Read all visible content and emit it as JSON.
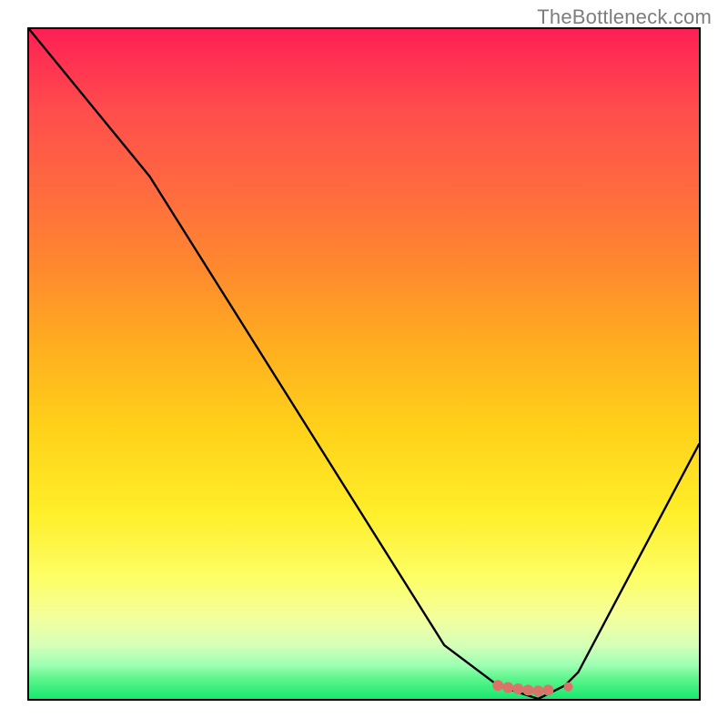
{
  "attribution": {
    "watermark": "TheBottleneck.com"
  },
  "chart_data": {
    "type": "line",
    "title": "",
    "xlabel": "",
    "ylabel": "",
    "xlim": [
      0,
      100
    ],
    "ylim": [
      0,
      100
    ],
    "grid": false,
    "legend": false,
    "annotations": [],
    "series": [
      {
        "name": "bottleneck-curve",
        "x": [
          0,
          18,
          62,
          70,
          76,
          80,
          82,
          100
        ],
        "values": [
          100,
          78,
          8,
          2,
          0,
          2,
          4,
          38
        ]
      }
    ],
    "marker_cluster": {
      "name": "optimal-region",
      "color": "#d9746a",
      "points_x": [
        70,
        71.5,
        73,
        74.5,
        76,
        77.5,
        80.5
      ],
      "points_y": [
        2,
        1.7,
        1.5,
        1.3,
        1.2,
        1.3,
        1.8
      ]
    },
    "background_gradient": {
      "stops": [
        {
          "pos": 0,
          "color": "#ff1f55"
        },
        {
          "pos": 12,
          "color": "#ff4d4d"
        },
        {
          "pos": 24,
          "color": "#ff6a3f"
        },
        {
          "pos": 36,
          "color": "#ff8a2e"
        },
        {
          "pos": 48,
          "color": "#ffb01f"
        },
        {
          "pos": 60,
          "color": "#ffd21a"
        },
        {
          "pos": 72,
          "color": "#ffee29"
        },
        {
          "pos": 82,
          "color": "#fdff66"
        },
        {
          "pos": 88,
          "color": "#f3ff9e"
        },
        {
          "pos": 92,
          "color": "#d6ffb8"
        },
        {
          "pos": 95,
          "color": "#9cffb3"
        },
        {
          "pos": 97,
          "color": "#5cf58c"
        },
        {
          "pos": 100,
          "color": "#17e86f"
        }
      ]
    }
  }
}
